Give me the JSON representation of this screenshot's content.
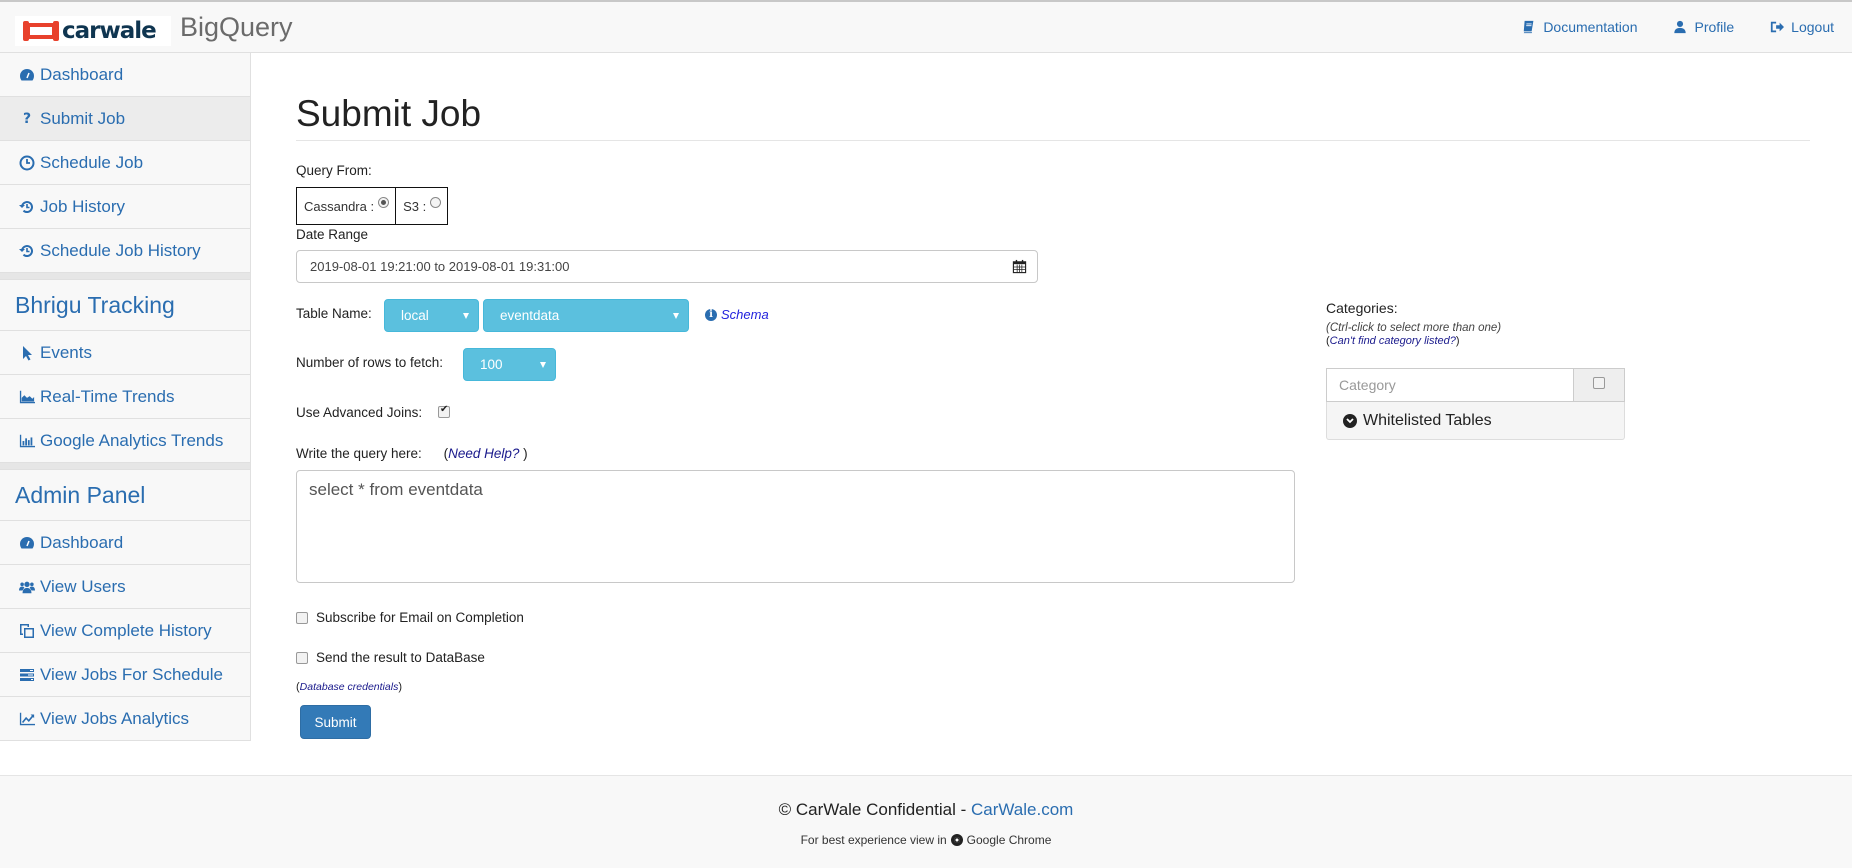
{
  "header": {
    "logo_text": "carwale",
    "app_name": "BigQuery",
    "nav": [
      {
        "label": "Documentation",
        "icon": "book-icon"
      },
      {
        "label": "Profile",
        "icon": "user-icon"
      },
      {
        "label": "Logout",
        "icon": "sign-out-icon"
      }
    ]
  },
  "sidebar": {
    "main_items": [
      {
        "label": "Dashboard",
        "icon": "dashboard-icon"
      },
      {
        "label": "Submit Job",
        "icon": "question-icon",
        "active": true
      },
      {
        "label": "Schedule Job",
        "icon": "clock-icon"
      },
      {
        "label": "Job History",
        "icon": "history-icon"
      },
      {
        "label": "Schedule Job History",
        "icon": "history-icon"
      }
    ],
    "tracking_heading": "Bhrigu Tracking",
    "tracking_items": [
      {
        "label": "Events",
        "icon": "pointer-icon"
      },
      {
        "label": "Real-Time Trends",
        "icon": "area-chart-icon"
      },
      {
        "label": "Google Analytics Trends",
        "icon": "bar-chart-icon"
      }
    ],
    "admin_heading": "Admin Panel",
    "admin_items": [
      {
        "label": "Dashboard",
        "icon": "dashboard-icon"
      },
      {
        "label": "View Users",
        "icon": "users-icon"
      },
      {
        "label": "View Complete History",
        "icon": "copy-icon"
      },
      {
        "label": "View Jobs For Schedule",
        "icon": "tasks-icon"
      },
      {
        "label": "View Jobs Analytics",
        "icon": "line-chart-icon"
      }
    ]
  },
  "form": {
    "title": "Submit Job",
    "query_from_label": "Query From:",
    "sources": [
      {
        "label": "Cassandra :",
        "selected": true
      },
      {
        "label": "S3 :",
        "selected": false
      }
    ],
    "date_range_label": "Date Range",
    "date_range_value": "2019-08-01 19:21:00 to 2019-08-01 19:31:00",
    "table_name_label": "Table Name:",
    "keyspace_selected": "local",
    "table_selected": "eventdata",
    "schema_link": "Schema",
    "rows_label": "Number of rows to fetch:",
    "rows_selected": "100",
    "advanced_joins_label": "Use Advanced Joins:",
    "advanced_joins_checked": true,
    "query_label": "Write the query here:",
    "need_help_link": "Need Help?",
    "query_value": "select * from eventdata",
    "email_label": "Subscribe for Email on Completion",
    "email_checked": false,
    "db_label": "Send the result to DataBase",
    "db_checked": false,
    "db_credentials_link": "Database credentials",
    "submit_label": "Submit"
  },
  "categories": {
    "title": "Categories:",
    "hint": "(Ctrl-click to select more than one)",
    "missing_link": "Can't find category listed?",
    "input_placeholder": "Category",
    "whitelisted_label": "Whitelisted Tables"
  },
  "footer": {
    "copyright": "© CarWale Confidential - ",
    "site_link": "CarWale.com",
    "browser_prefix": "For best experience view in",
    "browser_name": "Google Chrome"
  }
}
